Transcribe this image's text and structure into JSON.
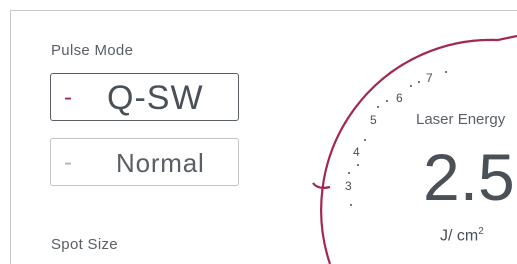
{
  "pulse_mode": {
    "label": "Pulse Mode",
    "options": [
      {
        "dash": "-",
        "text": "Q-SW",
        "selected": true
      },
      {
        "dash": "-",
        "text": "Normal",
        "selected": false
      }
    ]
  },
  "spot_size": {
    "label": "Spot Size"
  },
  "laser_energy": {
    "label": "Laser Energy",
    "value": "2.5",
    "unit": "J/ cm",
    "unit_exponent": "2",
    "scale": [
      "3",
      "4",
      "5",
      "6",
      "7"
    ]
  },
  "colors": {
    "accent": "#a3284f",
    "text": "#4a5058",
    "border": "#c4c4c4"
  }
}
